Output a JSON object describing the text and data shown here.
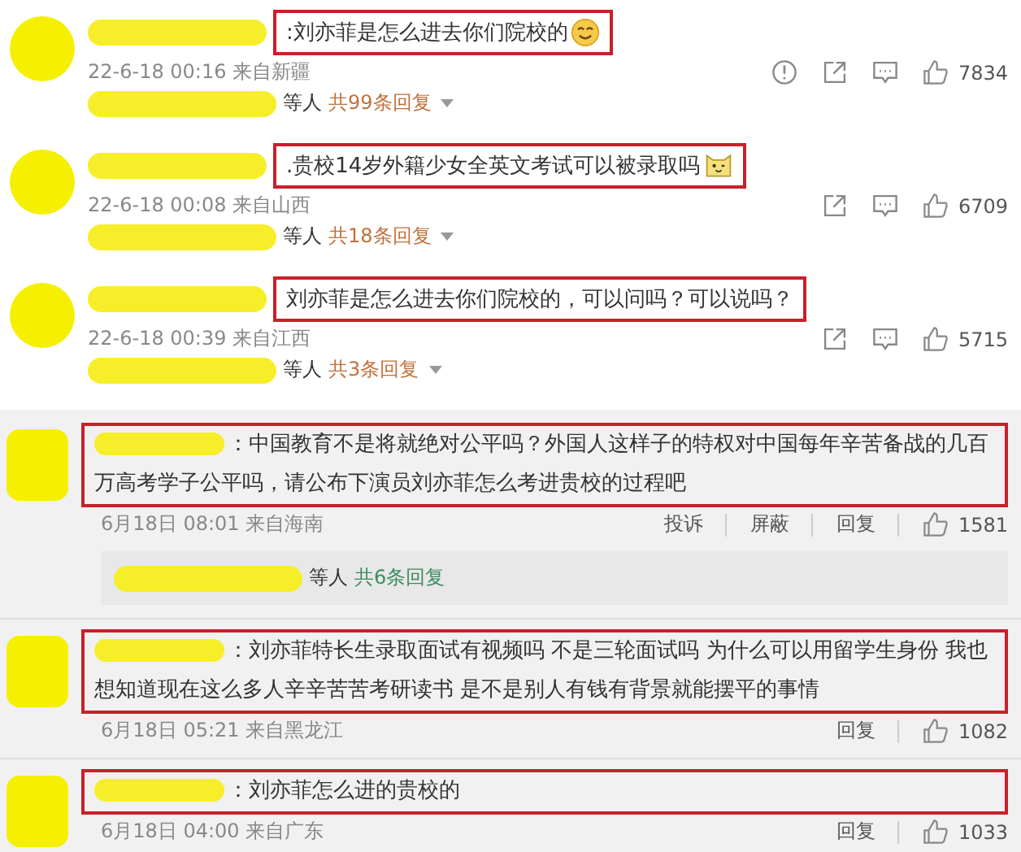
{
  "top_comments": [
    {
      "text": ":刘亦菲是怎么进去你们院校的",
      "emoji": {
        "kind": "smile"
      },
      "highlighted": true,
      "time": "22-6-18 00:16 来自新疆",
      "actions": [
        {
          "kind": "report"
        },
        {
          "kind": "share"
        },
        {
          "kind": "comment"
        }
      ],
      "likes": "7834",
      "replies": {
        "suffix": "等人",
        "count": "共99条回复"
      }
    },
    {
      "text": ".贵校14岁外籍少女全英文考试可以被录取吗",
      "emoji": {
        "kind": "cat"
      },
      "highlighted": true,
      "time": "22-6-18 00:08 来自山西",
      "actions": [
        {
          "kind": "share"
        },
        {
          "kind": "comment"
        }
      ],
      "likes": "6709",
      "replies": {
        "suffix": "等人",
        "count": "共18条回复"
      }
    },
    {
      "text": "刘亦菲是怎么进去你们院校的，可以问吗？可以说吗？",
      "highlighted": true,
      "time": "22-6-18 00:39 来自江西",
      "actions": [
        {
          "kind": "share"
        },
        {
          "kind": "comment"
        }
      ],
      "likes": "5715",
      "replies": {
        "suffix": "等人",
        "count": "共3条回复"
      }
    }
  ],
  "bottom_comments": [
    {
      "text": "：中国教育不是将就绝对公平吗？外国人这样子的特权对中国每年辛苦备战的几百万高考学子公平吗，请公布下演员刘亦菲怎么考进贵校的过程吧",
      "highlighted": true,
      "time": "6月18日 08:01 来自海南",
      "actions": [
        "投诉",
        "屏蔽",
        "回复"
      ],
      "likes": "1581",
      "replies": {
        "suffix": "等人",
        "count": "共6条回复"
      }
    },
    {
      "text": "：刘亦菲特长生录取面试有视频吗 不是三轮面试吗 为什么可以用留学生身份 我也想知道现在这么多人辛辛苦苦考研读书 是不是别人有钱有背景就能摆平的事情",
      "highlighted": true,
      "time": "6月18日 05:21 来自黑龙江",
      "actions": [
        "回复"
      ],
      "likes": "1082"
    },
    {
      "text": "：刘亦菲怎么进的贵校的",
      "highlighted": true,
      "time": "6月18日 04:00 来自广东",
      "actions": [
        "回复"
      ],
      "likes": "1033"
    }
  ]
}
